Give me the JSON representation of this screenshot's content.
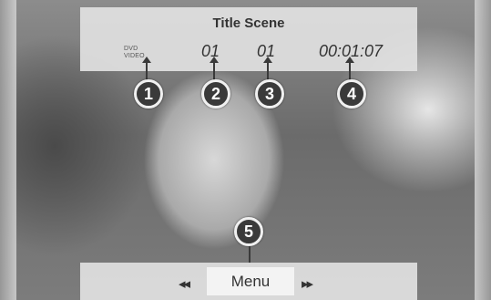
{
  "header": {
    "title": "Title Scene",
    "media_label": "DVD\nVIDEO",
    "title_number": "01",
    "scene_number": "01",
    "elapsed_time": "00:01:07"
  },
  "callouts": [
    "1",
    "2",
    "3",
    "4",
    "5"
  ],
  "controls": {
    "prev_icon": "◂◂",
    "menu_label": "Menu",
    "next_icon": "▸▸"
  },
  "colors": {
    "bar_bg": "#e1e1e1",
    "text": "#333333",
    "callout_bg": "#3a3a3a"
  }
}
